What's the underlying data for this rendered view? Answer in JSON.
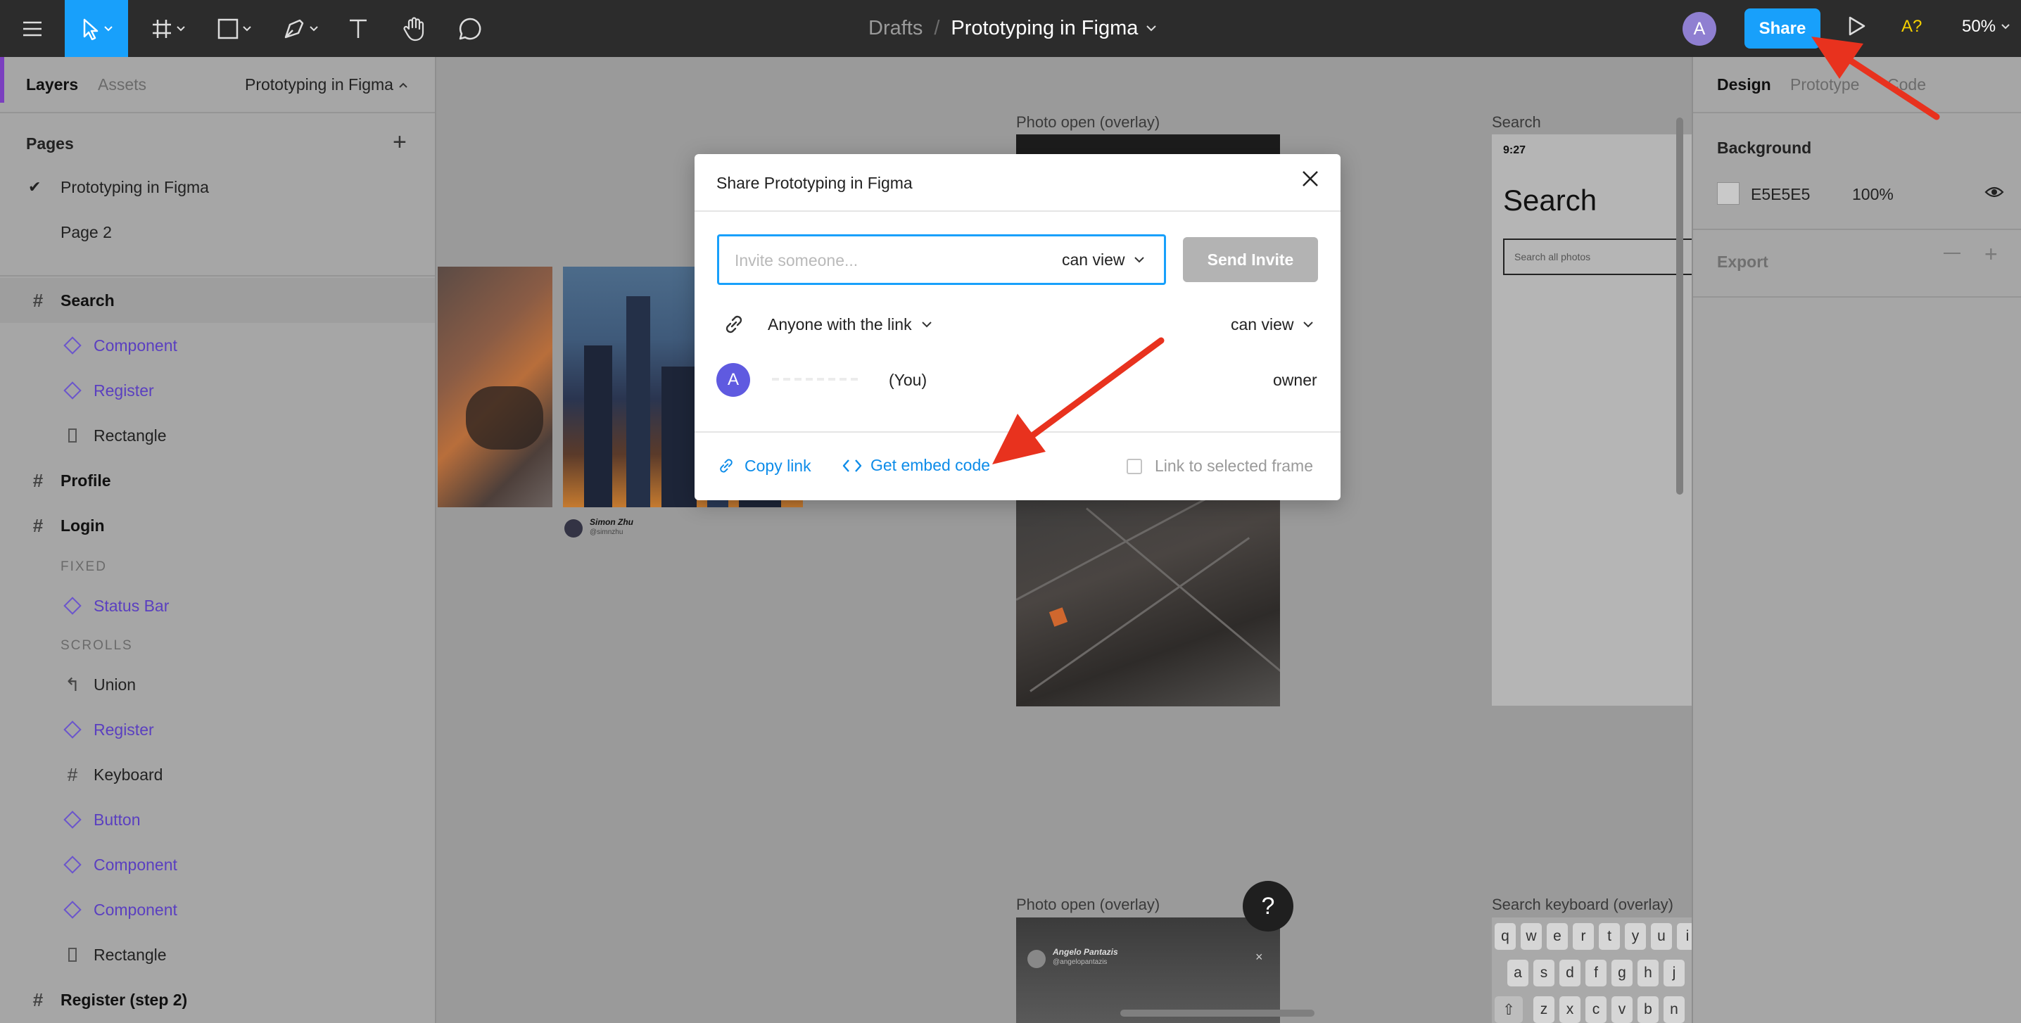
{
  "toolbar": {
    "breadcrumb_parent": "Drafts",
    "breadcrumb_separator": "/",
    "file_name": "Prototyping in Figma",
    "avatar_initial": "A",
    "share_label": "Share",
    "accessibility_label": "A?",
    "zoom_label": "50%",
    "icons": [
      "main-menu-icon",
      "move-tool-icon",
      "frame-tool-icon",
      "shape-tool-icon",
      "pen-tool-icon",
      "text-tool-icon",
      "hand-tool-icon",
      "comment-tool-icon",
      "present-icon"
    ],
    "active_color": "#18a0fb"
  },
  "left_panel": {
    "tabs": {
      "layers": "Layers",
      "assets": "Assets"
    },
    "file_name": "Prototyping in Figma",
    "pages_title": "Pages",
    "pages": [
      {
        "name": "Prototyping in Figma",
        "current": true
      },
      {
        "name": "Page 2",
        "current": false
      }
    ],
    "layers": [
      {
        "name": "Search",
        "type": "frame"
      },
      {
        "name": "Component",
        "type": "component"
      },
      {
        "name": "Register",
        "type": "component"
      },
      {
        "name": "Rectangle",
        "type": "rectangle"
      },
      {
        "name": "Profile",
        "type": "frame"
      },
      {
        "name": "Login",
        "type": "frame"
      },
      {
        "name": "FIXED",
        "type": "section"
      },
      {
        "name": "Status Bar",
        "type": "component"
      },
      {
        "name": "SCROLLS",
        "type": "section"
      },
      {
        "name": "Union",
        "type": "union"
      },
      {
        "name": "Register",
        "type": "component"
      },
      {
        "name": "Keyboard",
        "type": "frame-child"
      },
      {
        "name": "Button",
        "type": "component"
      },
      {
        "name": "Component",
        "type": "component"
      },
      {
        "name": "Component",
        "type": "component"
      },
      {
        "name": "Rectangle",
        "type": "rectangle"
      },
      {
        "name": "Register (step 2)",
        "type": "frame"
      }
    ]
  },
  "canvas": {
    "frame_labels": {
      "photo_open_top": "Photo open (overlay)",
      "search": "Search",
      "photo_open_bottom": "Photo open (overlay)",
      "search_keyboard": "Search keyboard (overlay)"
    },
    "credit_1": {
      "name": "Simon Zhu",
      "handle": "@simnzhu"
    },
    "search_frame": {
      "time": "9:27",
      "title": "Search",
      "placeholder": "Search all photos"
    },
    "credit_2": {
      "name": "Angelo Pantazis",
      "handle": "@angelopantazis",
      "close": "×"
    },
    "keyboard_rows": [
      [
        "q",
        "w",
        "e",
        "r",
        "t",
        "y",
        "u",
        "i"
      ],
      [
        "a",
        "s",
        "d",
        "f",
        "g",
        "h",
        "j"
      ],
      [
        "⇧",
        "z",
        "x",
        "c",
        "v",
        "b",
        "n"
      ]
    ],
    "help_label": "?"
  },
  "right_panel": {
    "tabs": {
      "design": "Design",
      "prototype": "Prototype",
      "code": "Code"
    },
    "background_title": "Background",
    "background_hex": "E5E5E5",
    "background_opacity": "100%",
    "background_color": "#e5e5e5",
    "export_title": "Export"
  },
  "share_dialog": {
    "title": "Share Prototyping in Figma",
    "invite_placeholder": "Invite someone...",
    "invite_permission": "can view",
    "send_label": "Send Invite",
    "link_access": "Anyone with the link",
    "link_permission": "can view",
    "user_initial": "A",
    "user_suffix": "(You)",
    "user_role": "owner",
    "copy_link_label": "Copy link",
    "embed_label": "Get embed code",
    "selected_frame_label": "Link to selected frame",
    "link_color": "#0d8ce9",
    "annotation_arrow_color": "#e8321e"
  }
}
